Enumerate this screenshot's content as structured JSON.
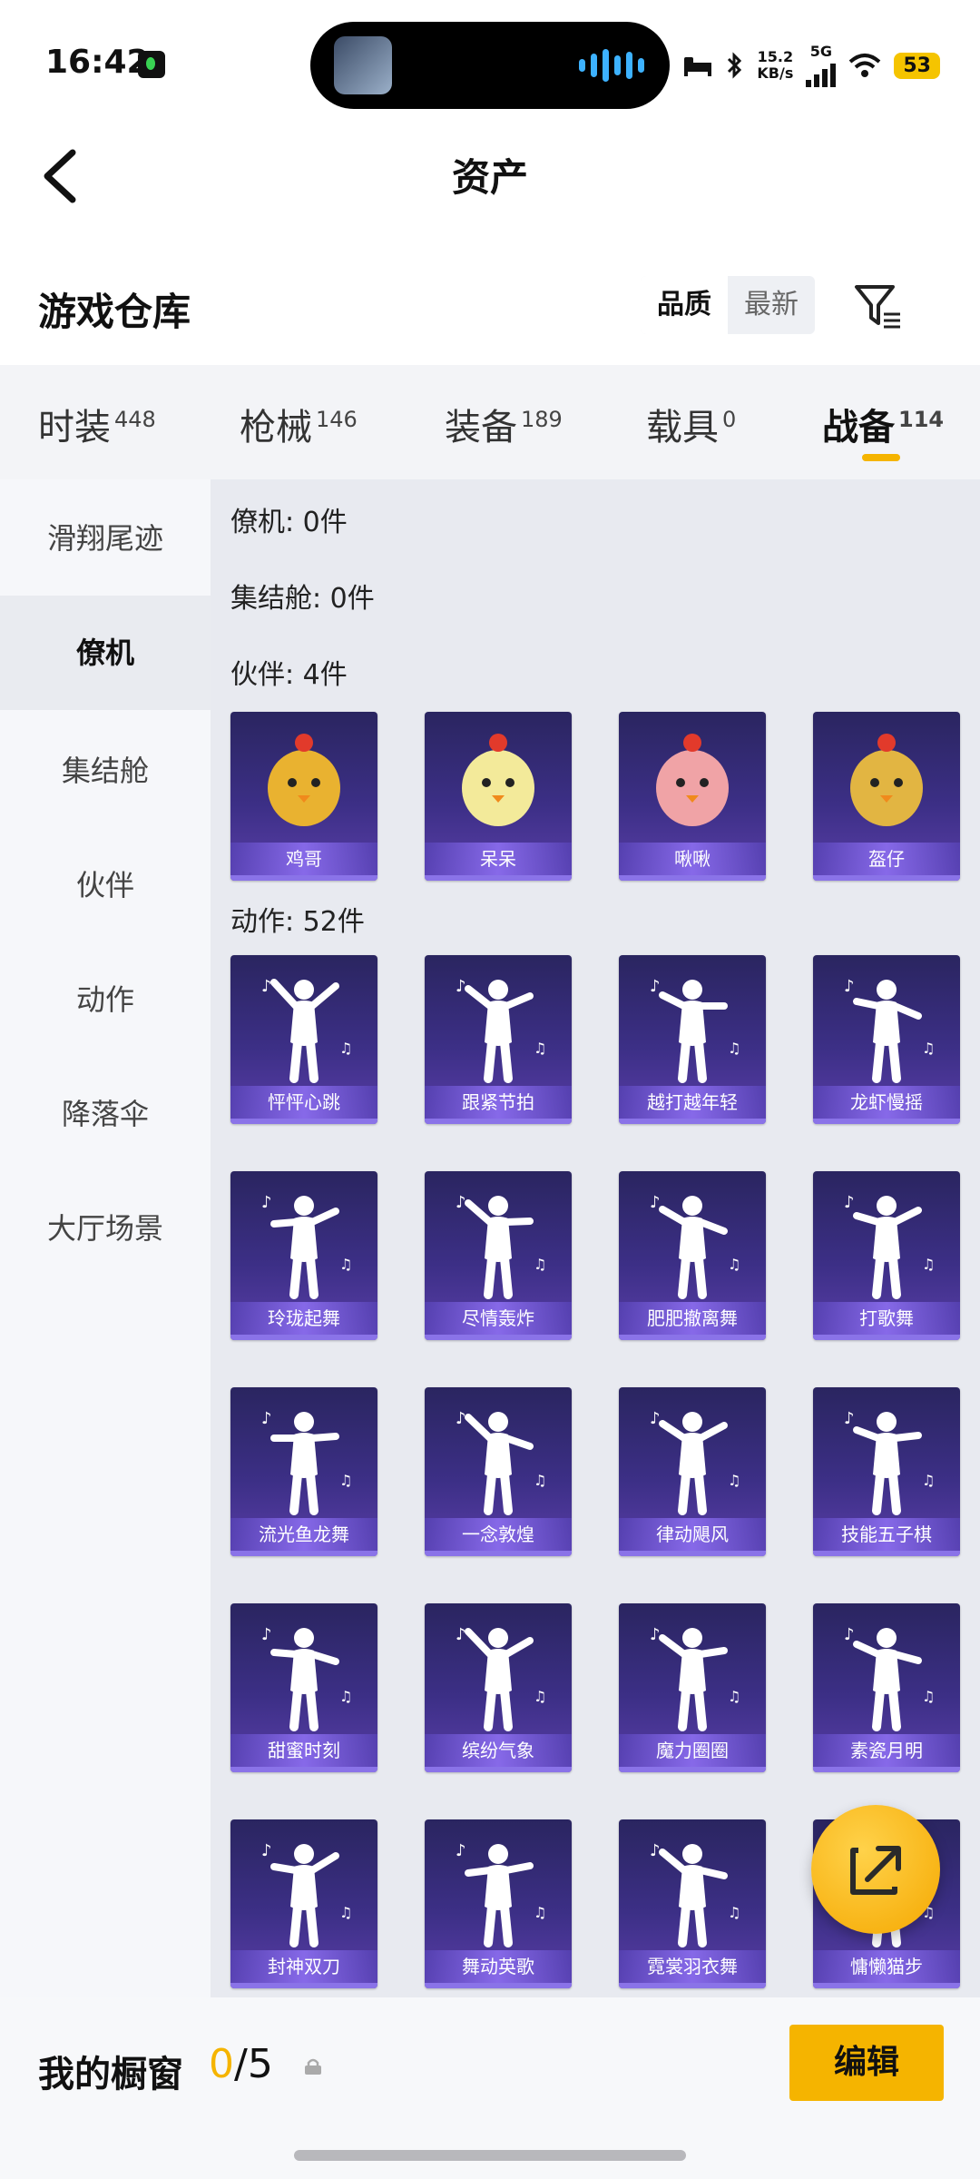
{
  "status_bar": {
    "time": "16:42",
    "net_speed": "15.2",
    "net_unit": "KB/s",
    "network_type": "5G",
    "battery": "53"
  },
  "header": {
    "title": "资产"
  },
  "section": {
    "title": "游戏仓库",
    "sort_quality": "品质",
    "sort_latest": "最新"
  },
  "tabs": [
    {
      "label": "时装",
      "count": "448"
    },
    {
      "label": "枪械",
      "count": "146"
    },
    {
      "label": "装备",
      "count": "189"
    },
    {
      "label": "载具",
      "count": "0"
    },
    {
      "label": "战备",
      "count": "114"
    }
  ],
  "sidebar": {
    "items": [
      "滑翔尾迹",
      "僚机",
      "集结舱",
      "伙伴",
      "动作",
      "降落伞",
      "大厅场景"
    ]
  },
  "categories": {
    "wingman": "僚机: 0件",
    "capsule": "集结舱: 0件",
    "partner": "伙伴: 4件",
    "action": "动作: 52件"
  },
  "partners": [
    "鸡哥",
    "呆呆",
    "啾啾",
    "盔仔"
  ],
  "actions": [
    "怦怦心跳",
    "跟紧节拍",
    "越打越年轻",
    "龙虾慢摇",
    "玲珑起舞",
    "尽情轰炸",
    "肥肥撤离舞",
    "打歌舞",
    "流光鱼龙舞",
    "一念敦煌",
    "律动飓风",
    "技能五子棋",
    "甜蜜时刻",
    "缤纷气象",
    "魔力圈圈",
    "素瓷月明",
    "封神双刀",
    "舞动英歌",
    "霓裳羽衣舞",
    "慵懒猫步"
  ],
  "bottom": {
    "label": "我的橱窗",
    "count_current": "0",
    "count_total": "/5",
    "edit": "编辑"
  },
  "colors": {
    "accent": "#f5b400",
    "card_bg": "#3c2f86"
  }
}
